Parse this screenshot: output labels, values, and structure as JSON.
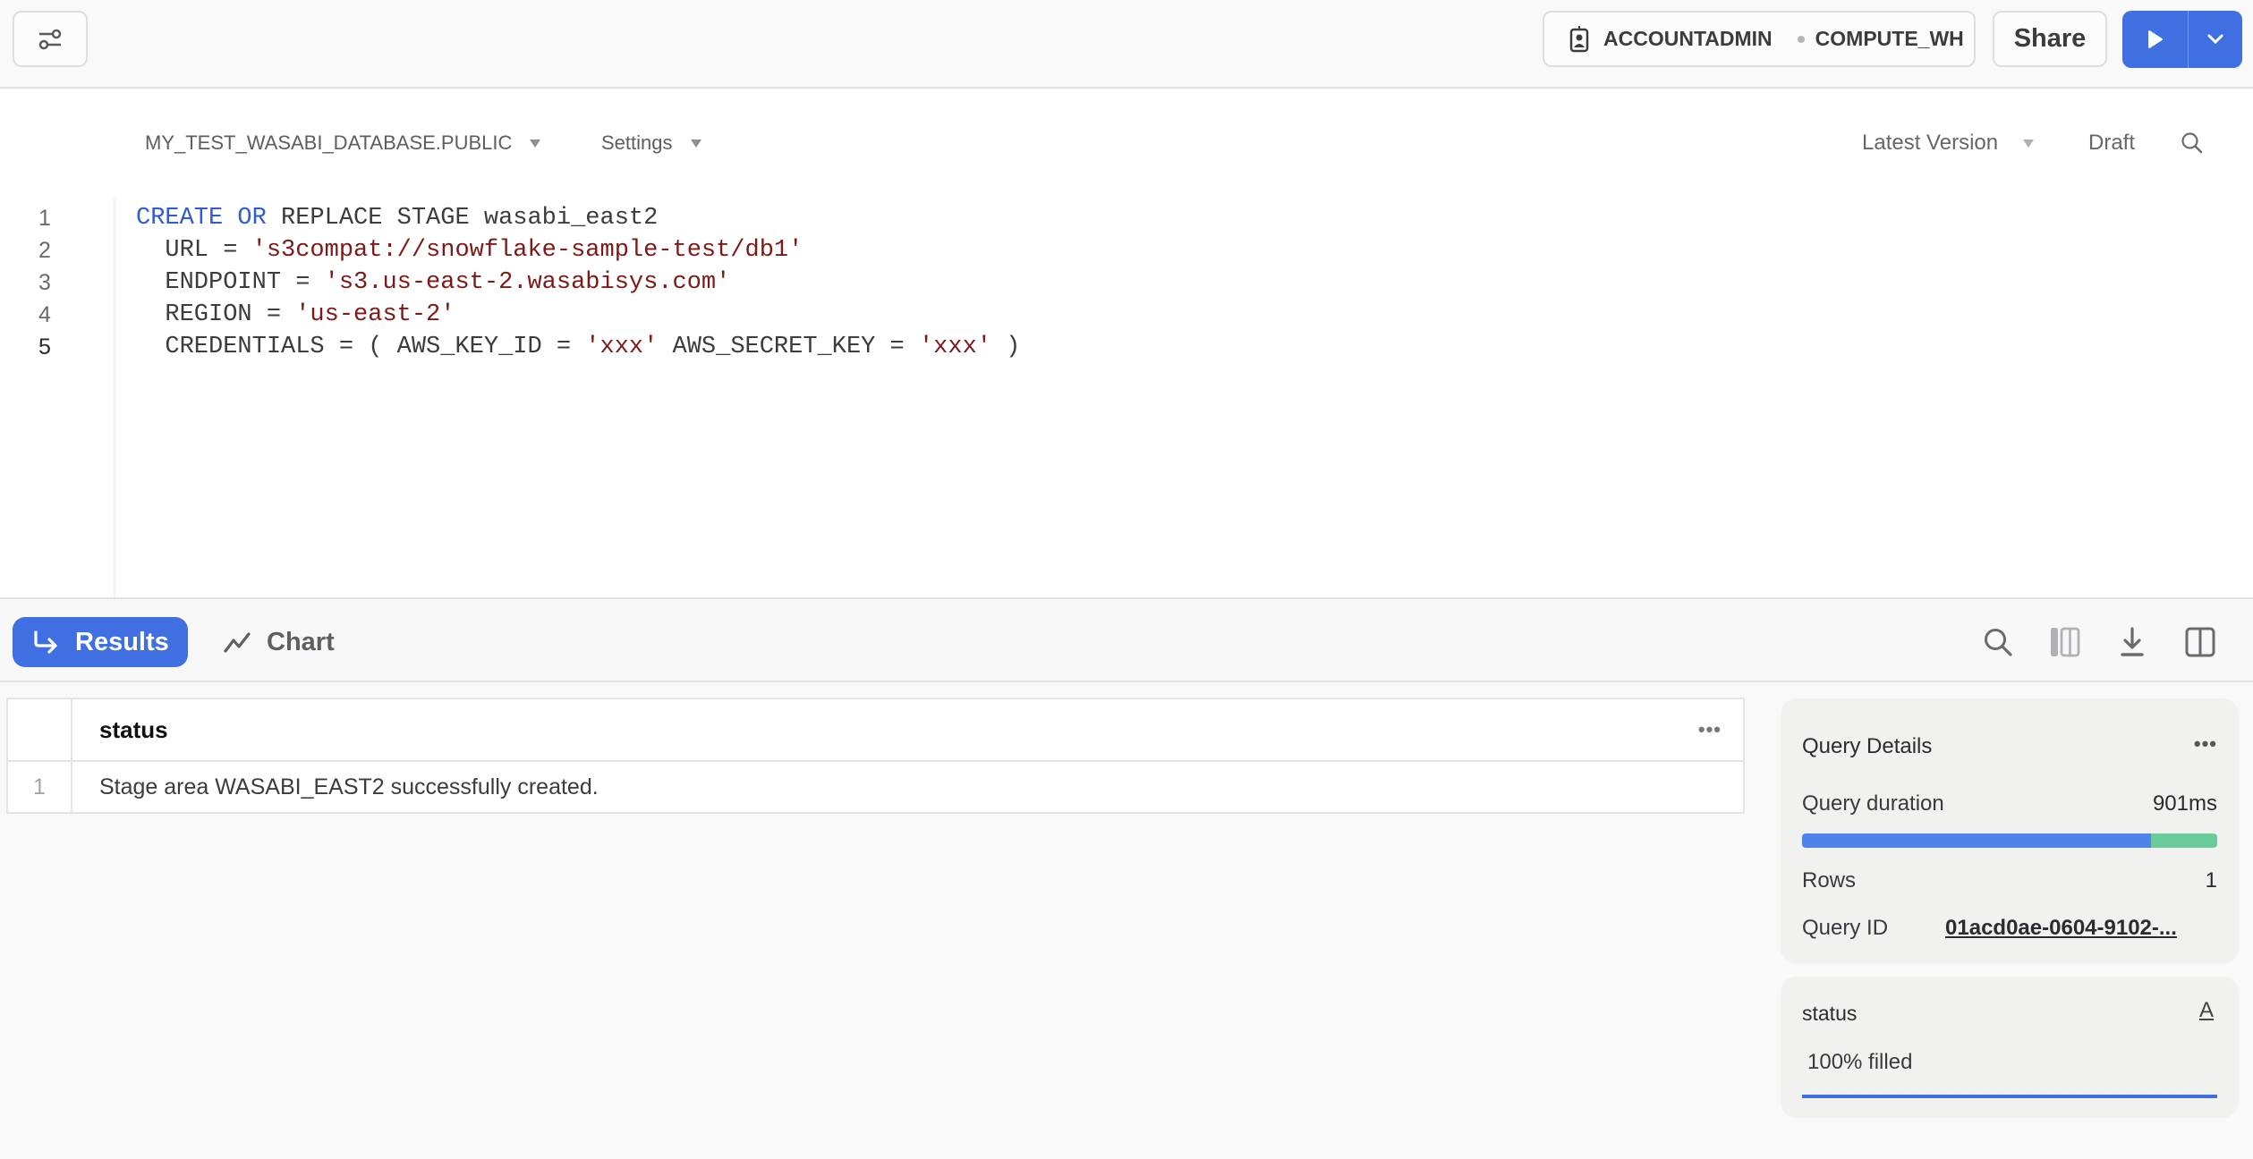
{
  "topbar": {
    "filter_icon": "sliders-icon",
    "role": "ACCOUNTADMIN",
    "warehouse": "COMPUTE_WH",
    "share_label": "Share",
    "run_icon": "play-icon",
    "run_menu_icon": "chevron-down-icon"
  },
  "editor": {
    "context": "MY_TEST_WASABI_DATABASE.PUBLIC",
    "settings_label": "Settings",
    "version_label": "Latest Version",
    "draft_label": "Draft",
    "active_line": 5,
    "lines": [
      {
        "n": "1",
        "tokens": [
          {
            "t": "CREATE",
            "c": "kw"
          },
          {
            "t": " "
          },
          {
            "t": "OR",
            "c": "kw"
          },
          {
            "t": " REPLACE STAGE wasabi_east2"
          }
        ]
      },
      {
        "n": "2",
        "tokens": [
          {
            "t": "  URL = "
          },
          {
            "t": "'s3compat://snowflake-sample-test/db1'",
            "c": "str"
          }
        ]
      },
      {
        "n": "3",
        "tokens": [
          {
            "t": "  ENDPOINT = "
          },
          {
            "t": "'s3.us-east-2.wasabisys.com'",
            "c": "str"
          }
        ]
      },
      {
        "n": "4",
        "tokens": [
          {
            "t": "  REGION = "
          },
          {
            "t": "'us-east-2'",
            "c": "str"
          }
        ]
      },
      {
        "n": "5",
        "tokens": [
          {
            "t": "  CREDENTIALS = ( AWS_KEY_ID = "
          },
          {
            "t": "'xxx'",
            "c": "str"
          },
          {
            "t": " AWS_SECRET_KEY = "
          },
          {
            "t": "'xxx'",
            "c": "str"
          },
          {
            "t": " )"
          }
        ]
      }
    ]
  },
  "results": {
    "tabs": [
      {
        "label": "Results",
        "icon": "results-arrow-icon",
        "active": true
      },
      {
        "label": "Chart",
        "icon": "chart-line-icon",
        "active": false
      }
    ],
    "tools": [
      "search-icon",
      "columns-icon",
      "download-icon",
      "split-panel-icon"
    ],
    "table": {
      "columns": [
        "status"
      ],
      "rows": [
        {
          "index": "1",
          "status": "Stage area WASABI_EAST2 successfully created."
        }
      ]
    }
  },
  "query_details": {
    "title": "Query Details",
    "duration_label": "Query duration",
    "duration_value": "901ms",
    "duration_split": {
      "primary_fraction": 0.84,
      "secondary_fraction": 0.16,
      "primary_color": "#5082e9",
      "secondary_color": "#6acc9a"
    },
    "rows_label": "Rows",
    "rows_value": "1",
    "query_id_label": "Query ID",
    "query_id_value": "01acd0ae-0604-9102-..."
  },
  "column_stats": {
    "column": "status",
    "type_glyph": "A",
    "fill_text": "100% filled",
    "fill_fraction": 1.0
  }
}
